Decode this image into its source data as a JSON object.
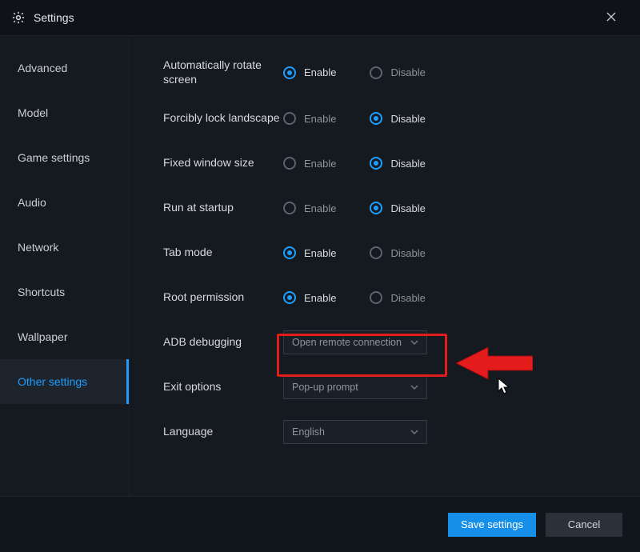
{
  "title": "Settings",
  "sidebar": {
    "items": [
      {
        "label": "Advanced"
      },
      {
        "label": "Model"
      },
      {
        "label": "Game settings"
      },
      {
        "label": "Audio"
      },
      {
        "label": "Network"
      },
      {
        "label": "Shortcuts"
      },
      {
        "label": "Wallpaper"
      },
      {
        "label": "Other settings"
      }
    ],
    "activeIndex": 7
  },
  "options": {
    "enable": "Enable",
    "disable": "Disable"
  },
  "rows": {
    "rotate": {
      "label": "Automatically rotate screen",
      "value": "enable"
    },
    "lock": {
      "label": "Forcibly lock landscape",
      "value": "disable"
    },
    "fixedwin": {
      "label": "Fixed window size",
      "value": "disable"
    },
    "startup": {
      "label": "Run at startup",
      "value": "disable"
    },
    "tabmode": {
      "label": "Tab mode",
      "value": "enable"
    },
    "root": {
      "label": "Root permission",
      "value": "enable"
    },
    "adb": {
      "label": "ADB debugging",
      "select": "Open remote connection"
    },
    "exit": {
      "label": "Exit options",
      "select": "Pop-up prompt"
    },
    "lang": {
      "label": "Language",
      "select": "English"
    }
  },
  "footer": {
    "save": "Save settings",
    "cancel": "Cancel"
  },
  "colors": {
    "accent": "#1e9dff",
    "primaryButton": "#168fe8",
    "highlight": "#e51c1c"
  }
}
